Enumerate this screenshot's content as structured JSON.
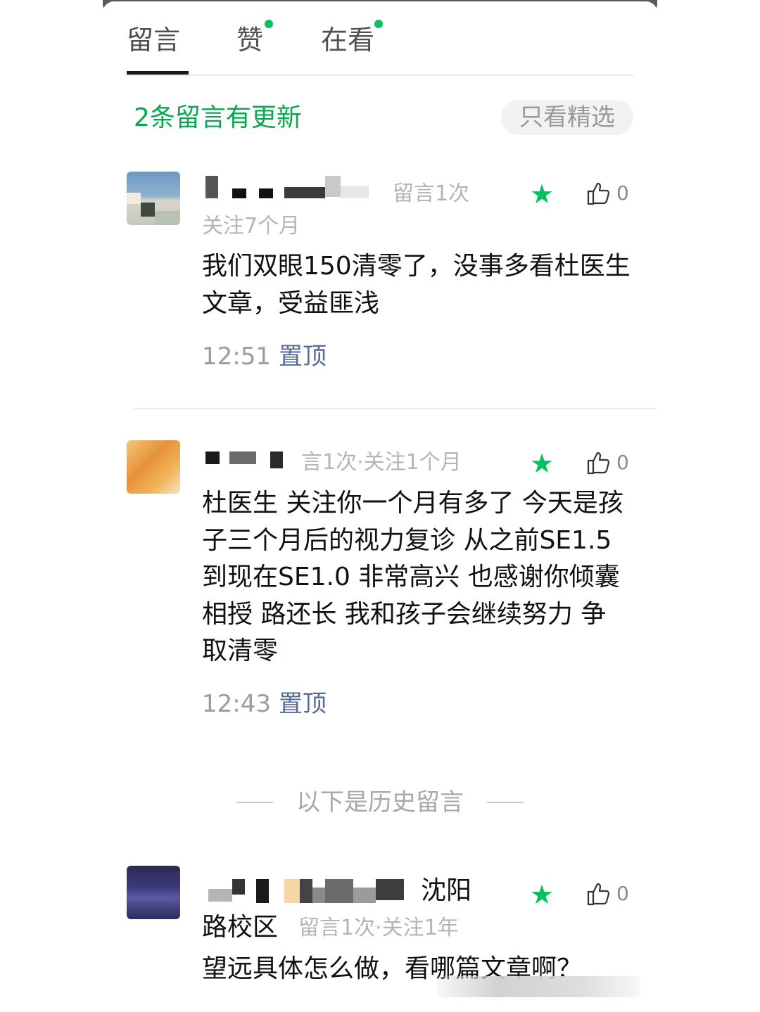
{
  "tabs": [
    {
      "label": "留言",
      "active": true,
      "dot": false
    },
    {
      "label": "赞",
      "active": false,
      "dot": true
    },
    {
      "label": "在看",
      "active": false,
      "dot": true
    }
  ],
  "update_notice": "2条留言有更新",
  "filter_button": "只看精选",
  "accent_color": "#07c160",
  "link_color": "#576b95",
  "comments": [
    {
      "meta_line1": "留言1次",
      "meta_line2": "关注7个月",
      "text": "我们双眼150清零了，没事多看杜医生文章，受益匪浅",
      "time": "12:51",
      "pin": "置顶",
      "likes": "0",
      "starred": true
    },
    {
      "meta_line1": "言1次·关注1个月",
      "text": "杜医生 关注你一个月有多了 今天是孩子三个月后的视力复诊 从之前SE1.5到现在SE1.0 非常高兴 也感谢你倾囊相授 路还长 我和孩子会继续努力 争取清零",
      "time": "12:43",
      "pin": "置顶",
      "likes": "0",
      "starred": true
    },
    {
      "name_tail": "沈阳",
      "name_line2": "路校区",
      "meta_line2": "留言1次·关注1年",
      "text": "望远具体怎么做，看哪篇文章啊？",
      "likes": "0",
      "starred": true
    }
  ],
  "history_divider": "以下是历史留言"
}
